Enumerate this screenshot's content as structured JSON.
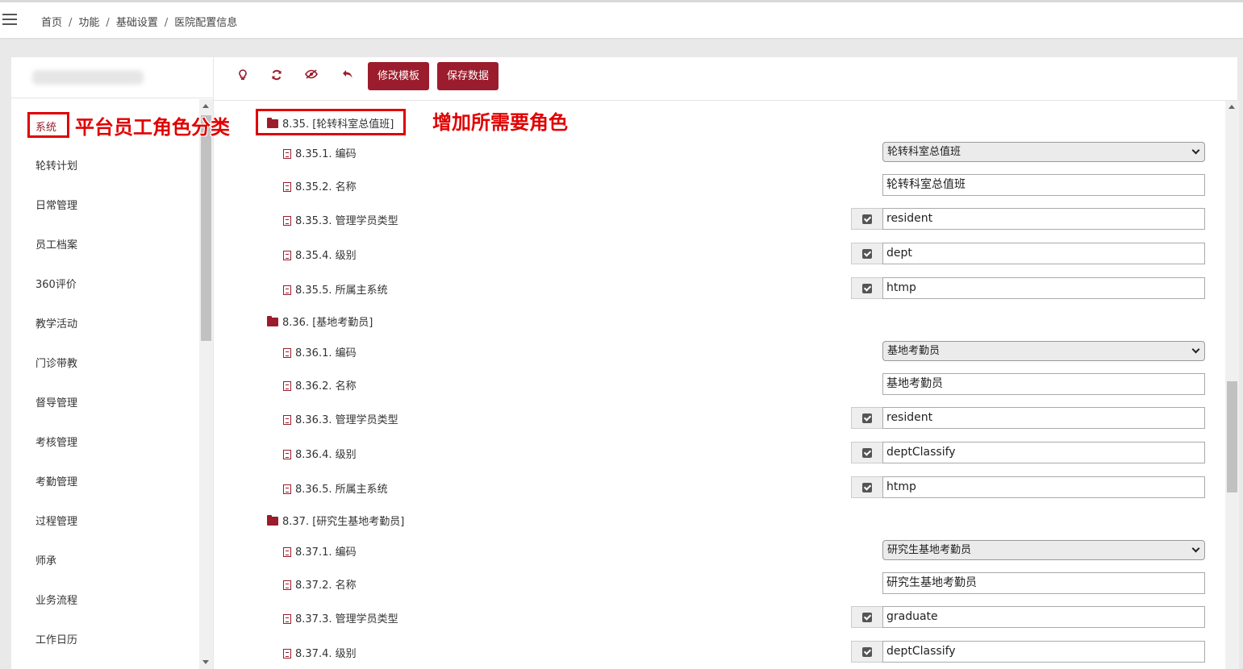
{
  "breadcrumb": [
    "首页",
    "功能",
    "基础设置",
    "医院配置信息"
  ],
  "breadcrumb_sep": "/",
  "sidebar": {
    "items": [
      {
        "label": "系统",
        "active": true
      },
      {
        "label": "轮转计划"
      },
      {
        "label": "日常管理"
      },
      {
        "label": "员工档案"
      },
      {
        "label": "360评价"
      },
      {
        "label": "教学活动"
      },
      {
        "label": "门诊带教"
      },
      {
        "label": "督导管理"
      },
      {
        "label": "考核管理"
      },
      {
        "label": "考勤管理"
      },
      {
        "label": "过程管理"
      },
      {
        "label": "师承"
      },
      {
        "label": "业务流程"
      },
      {
        "label": "工作日历"
      }
    ]
  },
  "toolbar": {
    "icons": [
      "lightbulb-icon",
      "refresh-icon",
      "eye-slash-icon",
      "undo-icon"
    ],
    "edit_template_label": "修改模板",
    "save_data_label": "保存数据"
  },
  "tree": [
    {
      "label": "8.35. [轮转科室总值班]",
      "fields": [
        {
          "label": "8.35.1. 编码",
          "type": "select",
          "value": "轮转科室总值班"
        },
        {
          "label": "8.35.2. 名称",
          "type": "input",
          "value": "轮转科室总值班"
        },
        {
          "label": "8.35.3. 管理学员类型",
          "type": "check",
          "value": "resident"
        },
        {
          "label": "8.35.4. 级别",
          "type": "check",
          "value": "dept"
        },
        {
          "label": "8.35.5. 所属主系统",
          "type": "check",
          "value": "htmp"
        }
      ]
    },
    {
      "label": "8.36. [基地考勤员]",
      "fields": [
        {
          "label": "8.36.1. 编码",
          "type": "select",
          "value": "基地考勤员"
        },
        {
          "label": "8.36.2. 名称",
          "type": "input",
          "value": "基地考勤员"
        },
        {
          "label": "8.36.3. 管理学员类型",
          "type": "check",
          "value": "resident"
        },
        {
          "label": "8.36.4. 级别",
          "type": "check",
          "value": "deptClassify"
        },
        {
          "label": "8.36.5. 所属主系统",
          "type": "check",
          "value": "htmp"
        }
      ]
    },
    {
      "label": "8.37. [研究生基地考勤员]",
      "fields": [
        {
          "label": "8.37.1. 编码",
          "type": "select",
          "value": "研究生基地考勤员"
        },
        {
          "label": "8.37.2. 名称",
          "type": "input",
          "value": "研究生基地考勤员"
        },
        {
          "label": "8.37.3. 管理学员类型",
          "type": "check",
          "value": "graduate"
        },
        {
          "label": "8.37.4. 级别",
          "type": "check",
          "value": "deptClassify"
        }
      ]
    }
  ],
  "annotations": {
    "left": "平台员工角色分类",
    "right": "增加所需要角色",
    "color": "#e00000"
  },
  "colors": {
    "accent": "#9b1c2c"
  }
}
